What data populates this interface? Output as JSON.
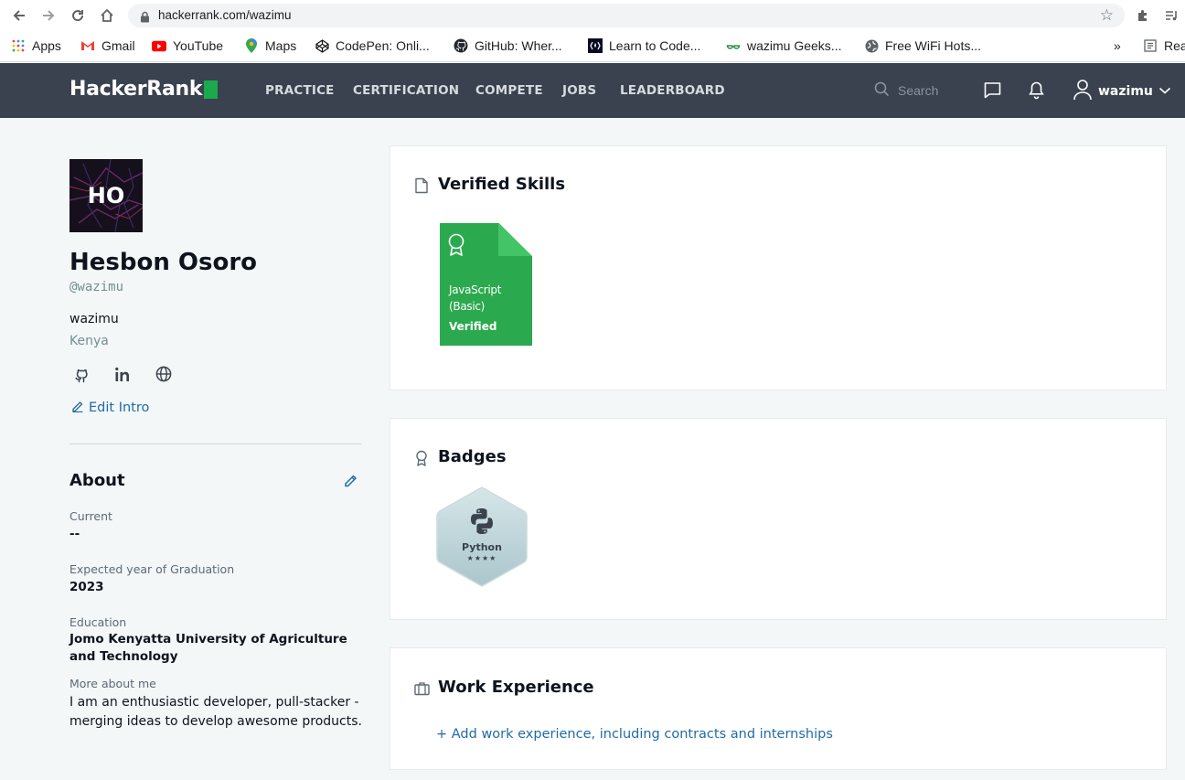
{
  "browser": {
    "url": "hackerrank.com/wazimu",
    "bookmarks": [
      {
        "label": "Apps",
        "icon": "apps-grid-icon"
      },
      {
        "label": "Gmail",
        "icon": "gmail-icon"
      },
      {
        "label": "YouTube",
        "icon": "youtube-icon"
      },
      {
        "label": "Maps",
        "icon": "maps-pin-icon"
      },
      {
        "label": "CodePen: Onli...",
        "icon": "codepen-icon"
      },
      {
        "label": "GitHub: Wher...",
        "icon": "github-icon"
      },
      {
        "label": "Learn to Code...",
        "icon": "freecodecamp-icon"
      },
      {
        "label": "wazimu Geeks...",
        "icon": "geeksforgeeks-icon"
      },
      {
        "label": "Free WiFi Hots...",
        "icon": "globe-icon"
      }
    ],
    "overflow": "»",
    "reading_list": "Rea"
  },
  "header": {
    "logo": "HackerRank",
    "nav": [
      "PRACTICE",
      "CERTIFICATION",
      "COMPETE",
      "JOBS",
      "LEADERBOARD"
    ],
    "search_placeholder": "Search",
    "username": "wazimu"
  },
  "profile": {
    "initials": "HO",
    "name": "Hesbon Osoro",
    "handle": "@wazimu",
    "username": "wazimu",
    "country": "Kenya",
    "edit_intro": "Edit Intro"
  },
  "about": {
    "title": "About",
    "fields": [
      {
        "label": "Current",
        "value": "--"
      },
      {
        "label": "Expected year of Graduation",
        "value": "2023"
      },
      {
        "label": "Education",
        "value": "Jomo Kenyatta University of Agriculture and Technology"
      },
      {
        "label": "More about me",
        "value": "I am an enthusiastic developer, pull-stacker - merging ideas to develop awesome products."
      }
    ]
  },
  "verified_skills": {
    "title": "Verified Skills",
    "items": [
      {
        "name": "JavaScript (Basic)",
        "status": "Verified"
      }
    ]
  },
  "badges": {
    "title": "Badges",
    "items": [
      {
        "name": "Python",
        "stars": "★★★★",
        "star_count": 4
      }
    ]
  },
  "work_experience": {
    "title": "Work Experience",
    "add_label": "+ Add work experience, including contracts and internships"
  },
  "colors": {
    "header_bg": "#39424e",
    "brand_green": "#1ba94c",
    "link_blue": "#1f6ba6",
    "page_bg": "#f3f7f7"
  }
}
